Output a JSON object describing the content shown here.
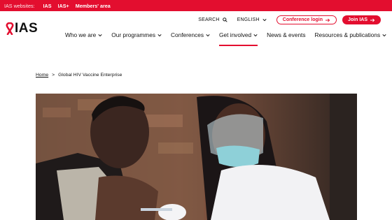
{
  "topbar": {
    "prefix": "IAS websites:",
    "links": [
      "IAS",
      "IAS+",
      "Members' area"
    ]
  },
  "logo": {
    "text": "IAS",
    "icon": "red-ribbon-icon"
  },
  "utility": {
    "search_label": "SEARCH",
    "language_label": "ENGLISH",
    "conference_login": "Conference login",
    "join": "Join IAS"
  },
  "nav": {
    "items": [
      {
        "label": "Who we are"
      },
      {
        "label": "Our programmes"
      },
      {
        "label": "Conferences"
      },
      {
        "label": "Get involved"
      },
      {
        "label": "News & events"
      },
      {
        "label": "Resources & publications"
      }
    ]
  },
  "breadcrumb": {
    "home": "Home",
    "separator": ">",
    "current": "Global HIV Vaccine Enterprise"
  },
  "colors": {
    "brand": "#e30e2f"
  }
}
